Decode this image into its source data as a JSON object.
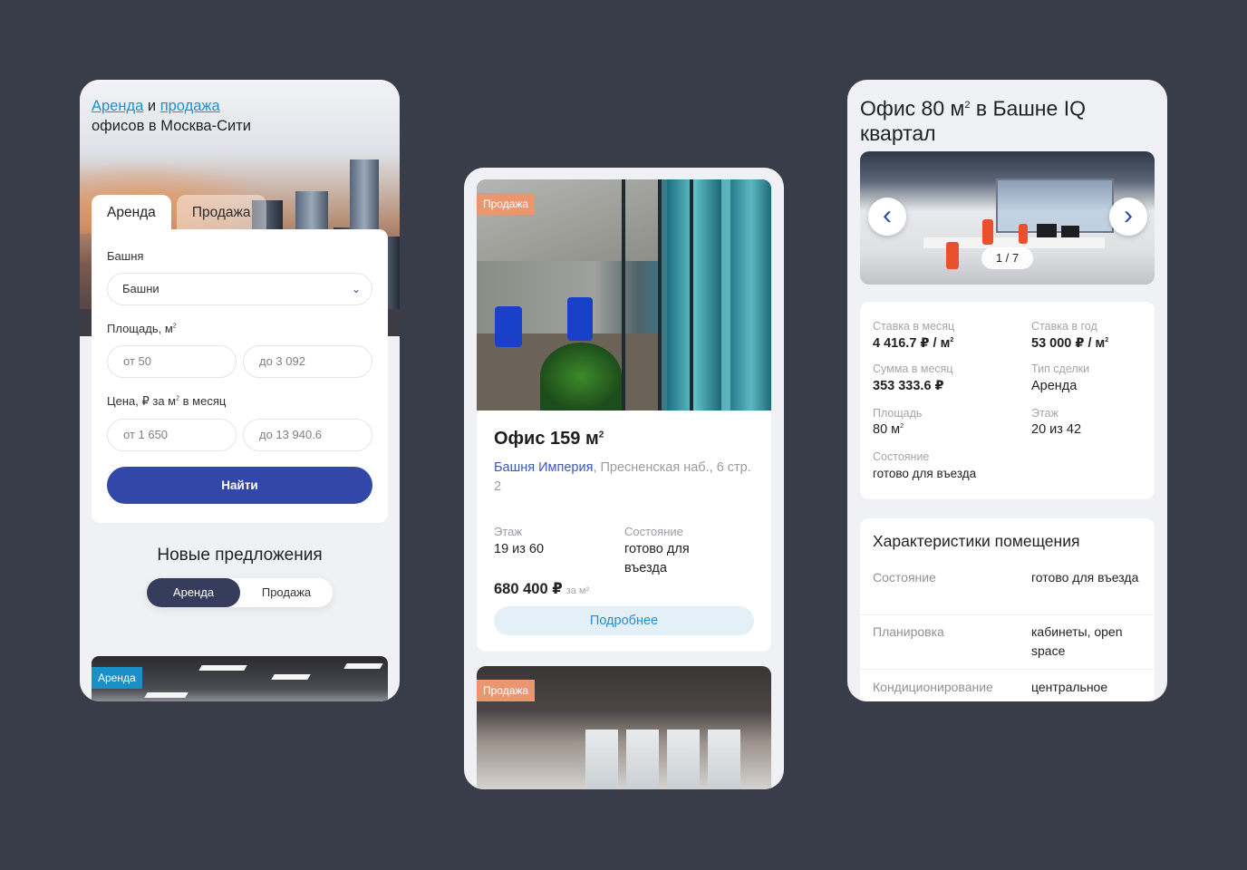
{
  "search_screen": {
    "title_link_rent": "Аренда",
    "title_and": "и",
    "title_link_sale": "продажа",
    "title_rest": "офисов в Москва-Сити",
    "tabs": [
      "Аренда",
      "Продажа"
    ],
    "tower_label": "Башня",
    "tower_value": "Башни",
    "area_label": "Площадь, м",
    "area_from": "от 50",
    "area_to": "до 3 092",
    "price_label": "Цена, ₽ за м",
    "price_label_suffix": "в месяц",
    "price_from": "от 1 650",
    "price_to": "до 13 940.6",
    "find_button": "Найти",
    "new_offers_title": "Новые предложения",
    "segment": [
      "Аренда",
      "Продажа"
    ],
    "teaser_badge": "Аренда"
  },
  "listing_screen": {
    "badge": "Продажа",
    "title": "Офис 159 м",
    "tower_link": "Башня Империя",
    "address": ", Пресненская наб., 6 стр. 2",
    "floor_label": "Этаж",
    "floor_value": "19 из 60",
    "state_label": "Состояние",
    "state_value": "готово для въезда",
    "price": "680 400 ₽",
    "price_unit": "за м²",
    "more_button": "Подробнее",
    "second_badge": "Продажа"
  },
  "detail_screen": {
    "title_part1": "Офис 80 м",
    "title_part2": " в Башне IQ квартал",
    "gallery_counter": "1 / 7",
    "stats": {
      "rate_month_label": "Ставка в месяц",
      "rate_month_value": "4 416.7 ₽ / м",
      "rate_year_label": "Ставка в год",
      "rate_year_value": "53 000 ₽ / м",
      "sum_month_label": "Сумма в месяц",
      "sum_month_value": "353 333.6 ₽",
      "deal_type_label": "Тип сделки",
      "deal_type_value": "Аренда",
      "area_label": "Площадь",
      "area_value": "80 м",
      "floor_label": "Этаж",
      "floor_value": "20 из 42",
      "state_label": "Состояние",
      "state_value": "готово для въезда"
    },
    "characteristics_title": "Характеристики помещения",
    "characteristics": [
      {
        "key": "Состояние",
        "value": "готово для въезда"
      },
      {
        "key": "Планировка",
        "value": "кабинеты, open space"
      },
      {
        "key": "Кондиционирование",
        "value": "центральное"
      }
    ]
  },
  "colors": {
    "background": "#393d4a",
    "accent": "#3347a8",
    "link": "#1f8fd6",
    "badge_rent": "#1a90c8",
    "badge_sale": "#ea9671"
  }
}
